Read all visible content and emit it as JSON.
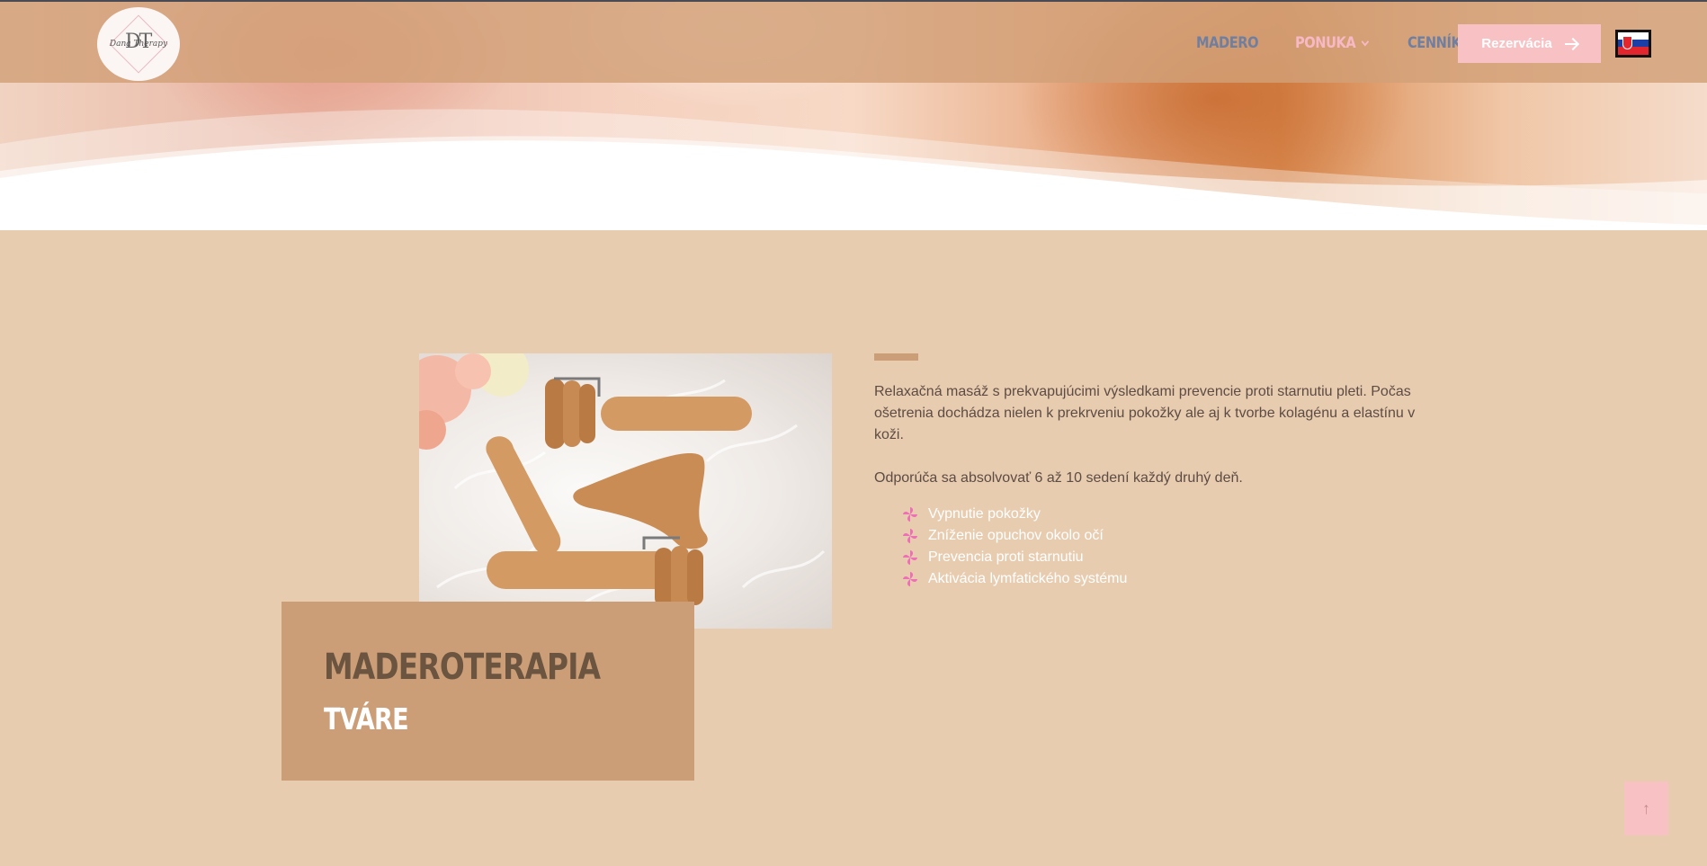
{
  "header": {
    "logo_text": "Dana Therapy",
    "logo_monogram": "DT",
    "nav": [
      {
        "label": "MADERO",
        "color": "#6f7fa1"
      },
      {
        "label": "PONUKA",
        "color": "#f7b9c6"
      },
      {
        "label": "CENNÍK",
        "color": "#6f7fa1"
      }
    ],
    "cta_label": "Rezervácia",
    "language_flag": "slovakia-flag"
  },
  "main": {
    "title": "MADEROTERAPIA",
    "subtitle": "TVÁRE",
    "description": "Relaxačná masáž s prekvapujúcimi výsledkami prevencie proti starnutiu pleti. Počas ošetrenia dochádza nielen k prekrveniu pokožky ale aj k tvorbe kolagénu a elastínu v koži.",
    "recommendation": "Odporúča sa absolvovať 6 až 10 sedení každý druhý deň.",
    "benefits": [
      "Vypnutie pokožky",
      "Zníženie opuchov okolo očí",
      "Prevencia proti starnutiu",
      "Aktivácia lymfatického systému"
    ],
    "image": "wooden-massage-tools-photo"
  },
  "scroll_top_icon": "arrow-up-icon",
  "colors": {
    "accent": "#cc9e78",
    "background": "#e8ccb0",
    "pink": "#f8c2c4",
    "nav_blue": "#6f7fa1"
  }
}
